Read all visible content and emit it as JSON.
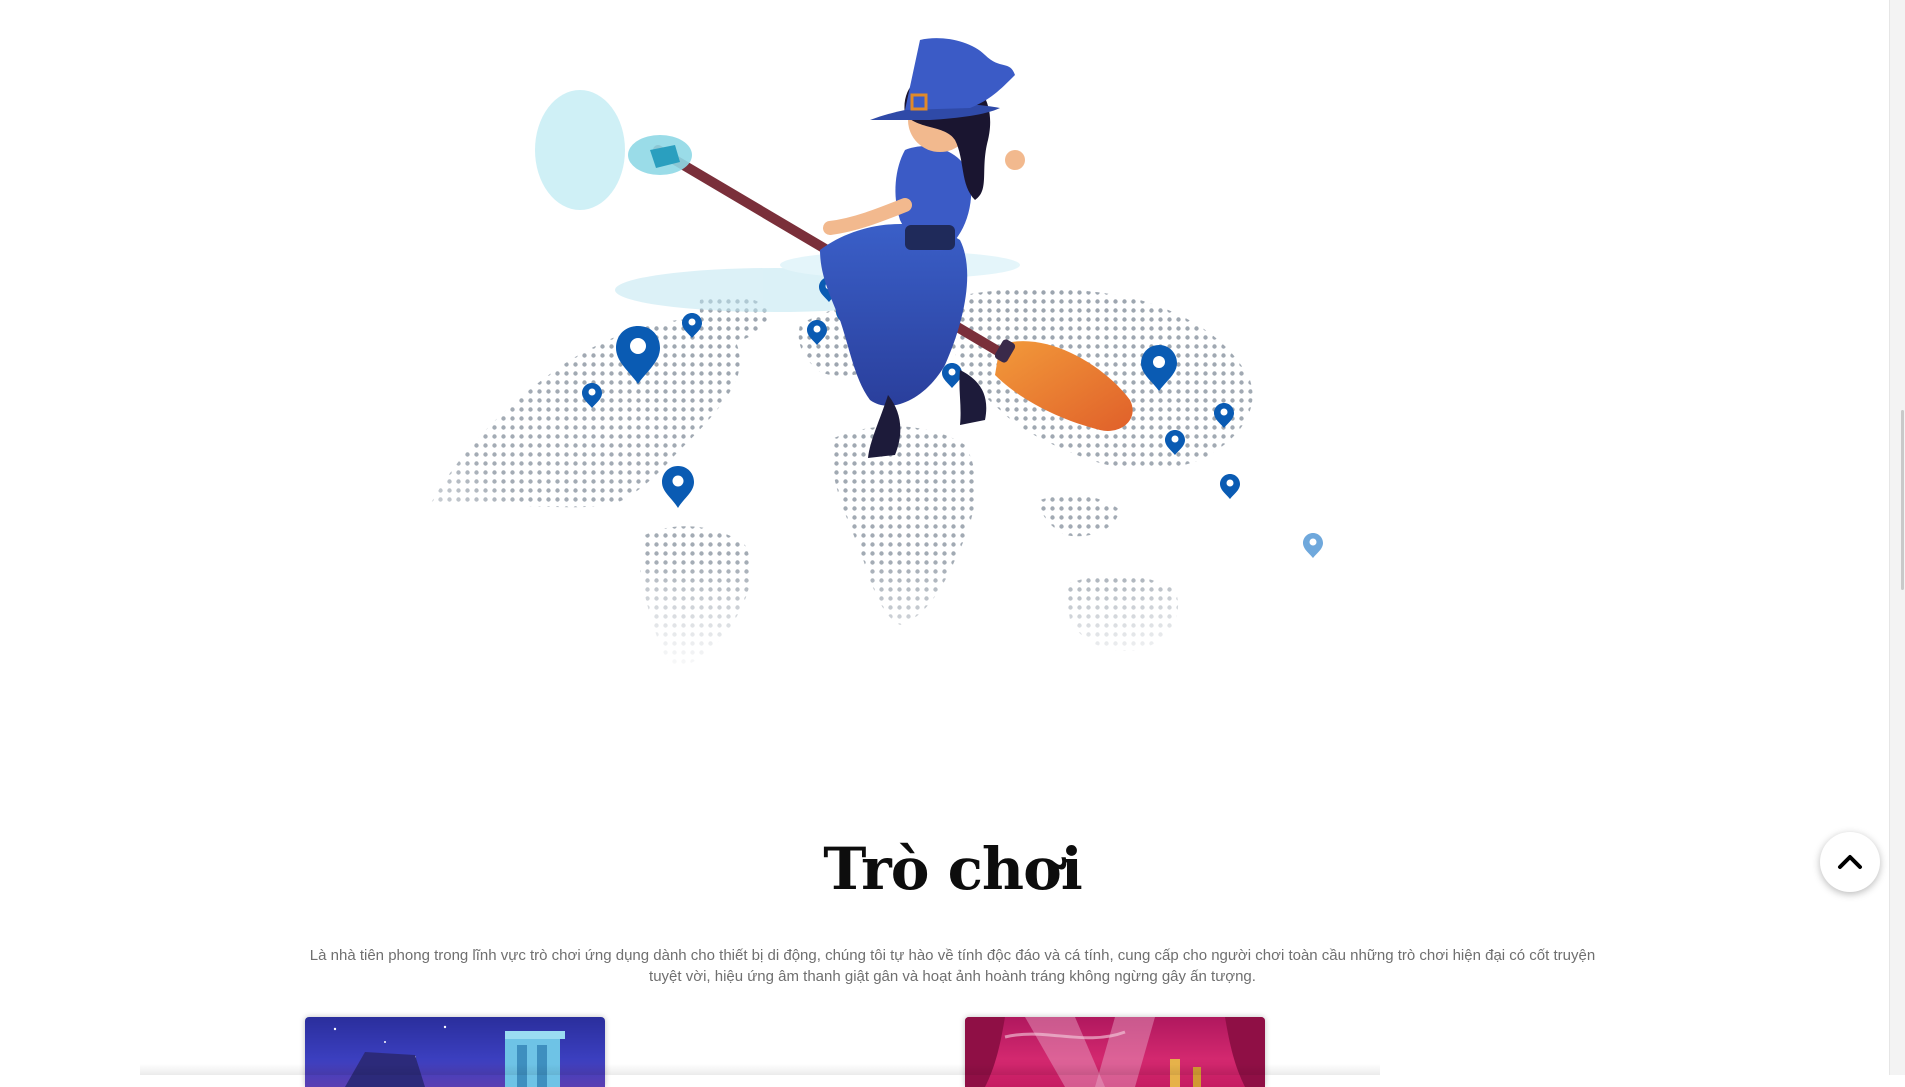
{
  "hero": {
    "illustration_icon": "witch-on-broom-over-world-map",
    "accent_pin_color": "#0a5bb3",
    "light_pin_color": "#6fa8dc"
  },
  "games_section": {
    "title": "Trò chơi",
    "description": "Là nhà tiên phong trong lĩnh vực trò chơi ứng dụng dành cho thiết bị di động, chúng tôi tự hào về tính độc đáo và cá tính, cung cấp cho người chơi toàn cầu những trò chơi hiện đại có cốt truyện tuyệt vời, hiệu ứng âm thanh giật gân và hoạt ảnh hoành tráng không ngừng gây ấn tượng."
  },
  "cards": [
    {
      "icon": "night-castle-thumbnail"
    },
    {
      "icon": "stage-curtain-thumbnail"
    }
  ],
  "back_to_top": {
    "icon": "chevron-up-icon"
  }
}
